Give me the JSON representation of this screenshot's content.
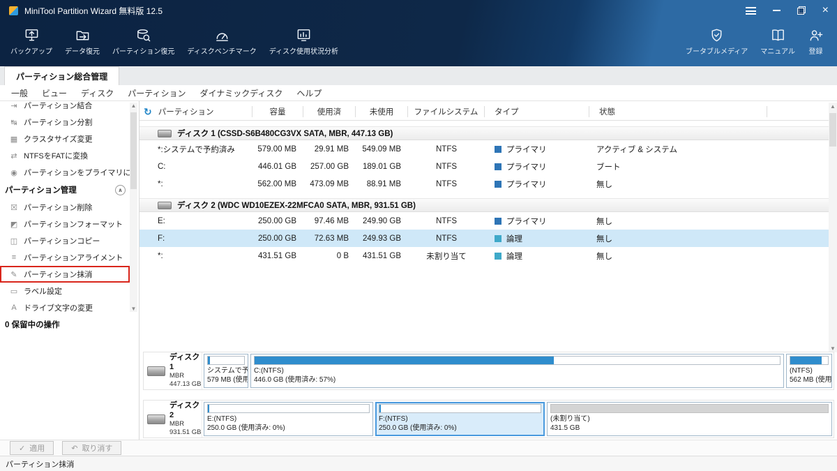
{
  "colors": {
    "primary_type": "#2e75b6",
    "logical_type": "#3fa9c9",
    "bar_fill": "#2f8dcd",
    "unalloc_fill": "#d4d4d4",
    "selection": "#cfe8f8",
    "highlight_red": "#d9261c"
  },
  "titlebar": {
    "title": "MiniTool Partition Wizard 無料版 12.5",
    "close": "×"
  },
  "toolbar": {
    "items_left": [
      {
        "icon": "backup-icon",
        "label": "バックアップ"
      },
      {
        "icon": "data-recovery-icon",
        "label": "データ復元"
      },
      {
        "icon": "partition-recovery-icon",
        "label": "パーティション復元"
      },
      {
        "icon": "disk-benchmark-icon",
        "label": "ディスクベンチマーク"
      },
      {
        "icon": "disk-usage-analysis-icon",
        "label": "ディスク使用状況分析"
      }
    ],
    "items_right": [
      {
        "icon": "bootable-media-icon",
        "label": "ブータブルメディア"
      },
      {
        "icon": "manual-icon",
        "label": "マニュアル"
      },
      {
        "icon": "register-icon",
        "label": "登録"
      }
    ]
  },
  "tabs": {
    "active": "パーティション総合管理"
  },
  "menubar": {
    "items": [
      "一般",
      "ビュー",
      "ディスク",
      "パーティション",
      "ダイナミックディスク",
      "ヘルプ"
    ]
  },
  "sidebar": {
    "top_items": [
      {
        "icon": "merge-partition-icon",
        "glyph": "⇥",
        "label": "パーティション結合"
      },
      {
        "icon": "split-partition-icon",
        "glyph": "↹",
        "label": "パーティション分割"
      },
      {
        "icon": "cluster-size-icon",
        "glyph": "▦",
        "label": "クラスタサイズ変更"
      },
      {
        "icon": "convert-ntfs-fat-icon",
        "glyph": "⇄",
        "label": "NTFSをFATに変換"
      },
      {
        "icon": "set-primary-icon",
        "glyph": "◉",
        "label": "パーティションをプライマリに設定"
      }
    ],
    "section_title": "パーティション管理",
    "section_chevron": "∧",
    "manage_items": [
      {
        "icon": "delete-partition-icon",
        "glyph": "☒",
        "label": "パーティション削除"
      },
      {
        "icon": "format-partition-icon",
        "glyph": "◩",
        "label": "パーティションフォーマット"
      },
      {
        "icon": "copy-partition-icon",
        "glyph": "◫",
        "label": "パーティションコピー"
      },
      {
        "icon": "align-partition-icon",
        "glyph": "≡",
        "label": "パーティションアライメント"
      },
      {
        "icon": "wipe-partition-icon",
        "glyph": "✎",
        "label": "パーティション抹消"
      },
      {
        "icon": "set-label-icon",
        "glyph": "▭",
        "label": "ラベル設定"
      },
      {
        "icon": "change-drive-letter-icon",
        "glyph": "A",
        "label": "ドライブ文字の変更"
      }
    ],
    "pending_label": "0 保留中の操作"
  },
  "table": {
    "refresh_icon": "↻",
    "columns": [
      "パーティション",
      "容量",
      "使用済",
      "未使用",
      "ファイルシステム",
      "タイプ",
      "状態"
    ],
    "groups": [
      {
        "header": "ディスク 1 (CSSD-S6B480CG3VX SATA, MBR, 447.13 GB)",
        "rows": [
          {
            "name": "*:システムで予約済み",
            "capacity": "579.00 MB",
            "used": "29.91 MB",
            "unused": "549.09 MB",
            "fs": "NTFS",
            "type": "プライマリ",
            "status": "アクティブ & システム"
          },
          {
            "name": "C:",
            "capacity": "446.01 GB",
            "used": "257.00 GB",
            "unused": "189.01 GB",
            "fs": "NTFS",
            "type": "プライマリ",
            "status": "ブート"
          },
          {
            "name": "*:",
            "capacity": "562.00 MB",
            "used": "473.09 MB",
            "unused": "88.91 MB",
            "fs": "NTFS",
            "type": "プライマリ",
            "status": "無し"
          }
        ]
      },
      {
        "header": "ディスク 2 (WDC WD10EZEX-22MFCA0 SATA, MBR, 931.51 GB)",
        "rows": [
          {
            "name": "E:",
            "capacity": "250.00 GB",
            "used": "97.46 MB",
            "unused": "249.90 GB",
            "fs": "NTFS",
            "type": "プライマリ",
            "status": "無し"
          },
          {
            "name": "F:",
            "capacity": "250.00 GB",
            "used": "72.63 MB",
            "unused": "249.93 GB",
            "fs": "NTFS",
            "type": "論理",
            "status": "無し",
            "selected": true
          },
          {
            "name": "*:",
            "capacity": "431.51 GB",
            "used": "0 B",
            "unused": "431.51 GB",
            "fs": "未割り当て",
            "type": "論理",
            "status": "無し"
          }
        ]
      }
    ]
  },
  "diskmap": {
    "disks": [
      {
        "name": "ディスク 1",
        "scheme": "MBR",
        "size": "447.13 GB",
        "blocks": [
          {
            "line1": "システムで予約",
            "line2": "579 MB (使用",
            "fill": "6%"
          },
          {
            "line1": "C:(NTFS)",
            "line2": "446.0 GB (使用済み: 57%)",
            "fill": "57%"
          },
          {
            "line1": "(NTFS)",
            "line2": "562 MB (使用",
            "fill": "84%"
          }
        ]
      },
      {
        "name": "ディスク 2",
        "scheme": "MBR",
        "size": "931.51 GB",
        "blocks": [
          {
            "line1": "E:(NTFS)",
            "line2": "250.0 GB (使用済み: 0%)",
            "fill": "1%"
          },
          {
            "line1": "F:(NTFS)",
            "line2": "250.0 GB (使用済み: 0%)",
            "fill": "1%",
            "selected": true
          },
          {
            "line1": "(未割り当て)",
            "line2": "431.5 GB",
            "fill": "100%"
          }
        ]
      }
    ]
  },
  "actions": {
    "apply_icon": "✓",
    "apply": "適用",
    "undo_icon": "↶",
    "undo": "取り消す"
  },
  "statusbar": {
    "text": "パーティション抹消"
  }
}
